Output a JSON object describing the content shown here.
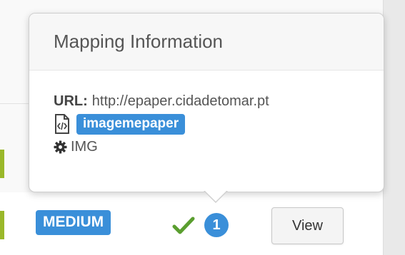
{
  "popover": {
    "title": "Mapping Information",
    "url_label": "URL:",
    "url_value": "http://epaper.cidadetomar.pt",
    "file_icon": "file-code-icon",
    "tag": "imagemepaper",
    "type_icon": "gear-icon",
    "type": "IMG"
  },
  "row": {
    "level": "MEDIUM",
    "status_icon": "check-icon",
    "count": "1",
    "view_label": "View"
  },
  "colors": {
    "accent_blue": "#3a8fd9",
    "check_green": "#5a9e2f",
    "row_accent": "#9ab82a"
  }
}
